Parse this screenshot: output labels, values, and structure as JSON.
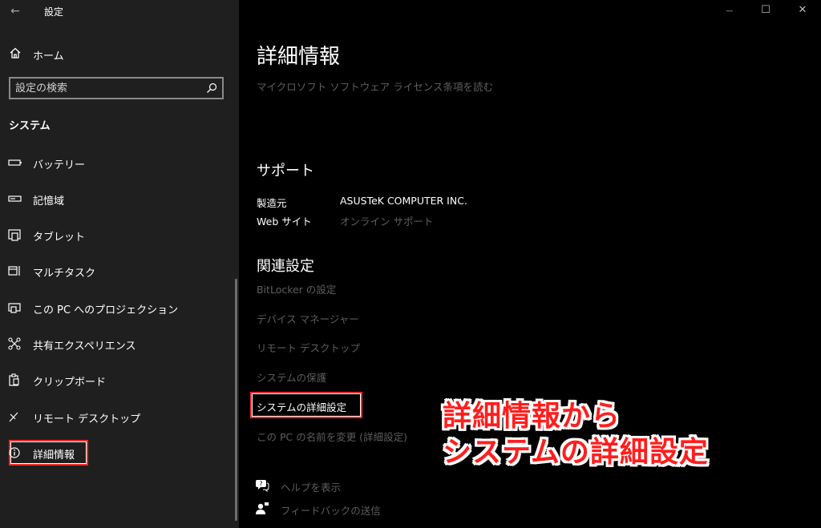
{
  "window": {
    "title": "設定",
    "back_glyph": "←",
    "minimize_glyph": "—",
    "maximize_glyph": "☐",
    "close_glyph": "✕"
  },
  "sidebar": {
    "home_label": "ホーム",
    "search_placeholder": "設定の検索",
    "section_title": "システム",
    "items": [
      {
        "label": "バッテリー",
        "icon": "battery-icon"
      },
      {
        "label": "記憶域",
        "icon": "storage-icon"
      },
      {
        "label": "タブレット",
        "icon": "tablet-icon"
      },
      {
        "label": "マルチタスク",
        "icon": "multitask-icon"
      },
      {
        "label": "この PC へのプロジェクション",
        "icon": "projection-icon"
      },
      {
        "label": "共有エクスペリエンス",
        "icon": "shared-experience-icon"
      },
      {
        "label": "クリップボード",
        "icon": "clipboard-icon"
      },
      {
        "label": "リモート デスクトップ",
        "icon": "remote-desktop-icon"
      },
      {
        "label": "詳細情報",
        "icon": "info-icon",
        "active": true
      }
    ]
  },
  "main": {
    "title": "詳細情報",
    "license_link": "マイクロソフト ソフトウェア ライセンス条項を読む",
    "support": {
      "heading": "サポート",
      "manufacturer_label": "製造元",
      "manufacturer_value": "ASUSTeK COMPUTER INC.",
      "website_label": "Web サイト",
      "website_value": "オンライン サポート"
    },
    "related": {
      "heading": "関連設定",
      "links": [
        "BitLocker の設定",
        "デバイス マネージャー",
        "リモート デスクトップ",
        "システムの保護",
        "システムの詳細設定",
        "この PC の名前を変更 (詳細設定)"
      ]
    },
    "help_label": "ヘルプを表示",
    "feedback_label": "フィードバックの送信"
  },
  "annotation": {
    "line1": "詳細情報から",
    "line2": "システムの詳細設定"
  },
  "colors": {
    "sidebar_bg": "#1f1f1f",
    "main_bg": "#000000",
    "highlight": "#ff2b2b",
    "dim_text": "#5e5e5e"
  }
}
